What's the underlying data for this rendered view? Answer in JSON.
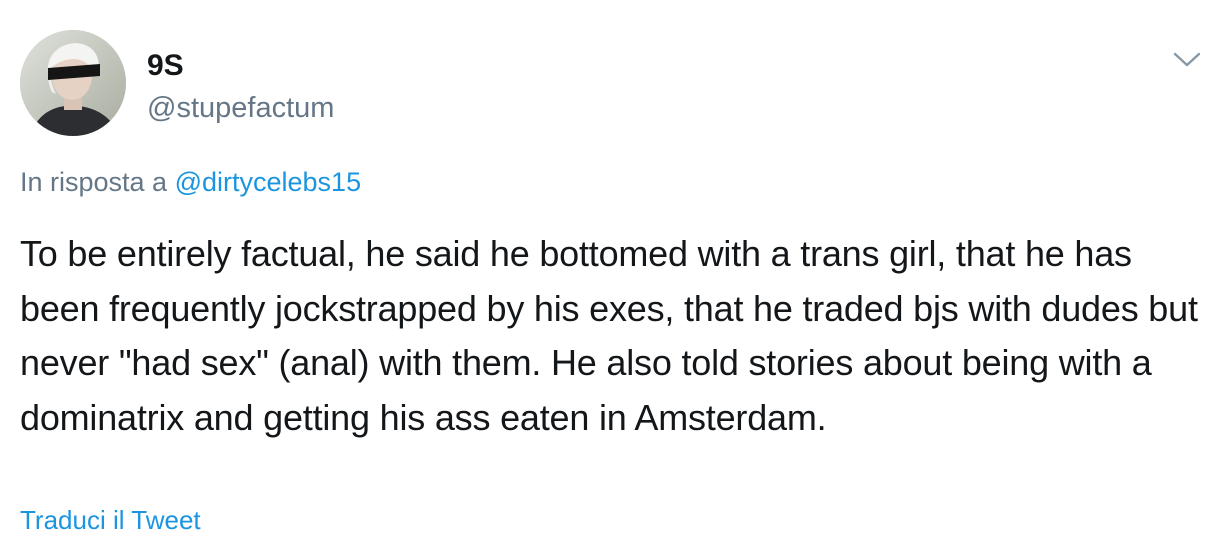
{
  "user": {
    "display_name": "9S",
    "handle": "@stupefactum"
  },
  "menu": {
    "icon": "chevron-down-icon"
  },
  "reply": {
    "prefix": "In risposta a",
    "mention": "@dirtycelebs15"
  },
  "tweet": {
    "text": "To be entirely factual, he said he bottomed with a trans girl, that he has been frequently jockstrapped by his exes, that he traded bjs with dudes but never \"had sex\" (anal) with them. He also told stories about being with a dominatrix and getting his ass eaten in Amsterdam."
  },
  "actions": {
    "translate_label": "Traduci il Tweet"
  },
  "colors": {
    "text": "#14171a",
    "secondary": "#657786",
    "link": "#1b95e0"
  }
}
